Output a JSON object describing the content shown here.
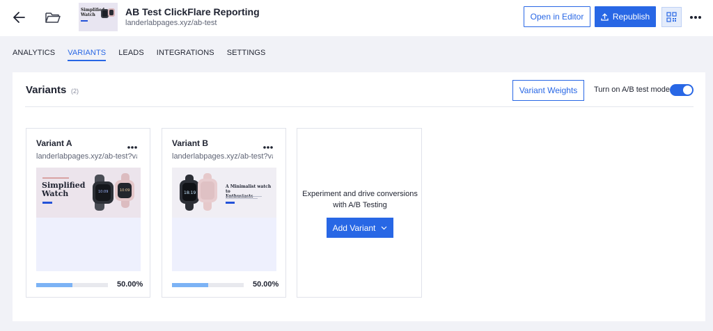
{
  "header": {
    "title": "AB Test ClickFlare Reporting",
    "url": "landerlabpages.xyz/ab-test",
    "thumbnail_title_line1": "Simplified",
    "thumbnail_title_line2": "Watch",
    "open_editor_label": "Open in Editor",
    "republish_label": "Republish",
    "icons": [
      "back-arrow-icon",
      "folder-icon",
      "upload-icon",
      "qr-code-icon",
      "more-horizontal-icon"
    ]
  },
  "tabs": [
    {
      "label": "ANALYTICS",
      "active": false
    },
    {
      "label": "VARIANTS",
      "active": true
    },
    {
      "label": "LEADS",
      "active": false
    },
    {
      "label": "INTEGRATIONS",
      "active": false
    },
    {
      "label": "SETTINGS",
      "active": false
    }
  ],
  "variants_section": {
    "title": "Variants",
    "count": "(2)",
    "weights_button": "Variant Weights",
    "ab_test_label": "Turn on A/B test mode",
    "ab_test_enabled": true
  },
  "variants": [
    {
      "name": "Variant A",
      "url": "landerlabpages.xyz/ab-test?va...",
      "weight_label": "50.00%",
      "weight_fraction": 0.5,
      "preview_title_line1": "Simplified",
      "preview_title_line2": "Watch"
    },
    {
      "name": "Variant B",
      "url": "landerlabpages.xyz/ab-test?va...",
      "weight_label": "50.00%",
      "weight_fraction": 0.5,
      "preview_title_line1": "A Minimalist watch to",
      "preview_title_line2": "Enthusiasts"
    }
  ],
  "add_variant": {
    "text_line1": "Experiment and drive conversions",
    "text_line2": "with A/B Testing",
    "button_label": "Add Variant"
  },
  "colors": {
    "accent": "#2867e5",
    "background": "#f1f2f7",
    "progress": "#7cb3f5"
  }
}
